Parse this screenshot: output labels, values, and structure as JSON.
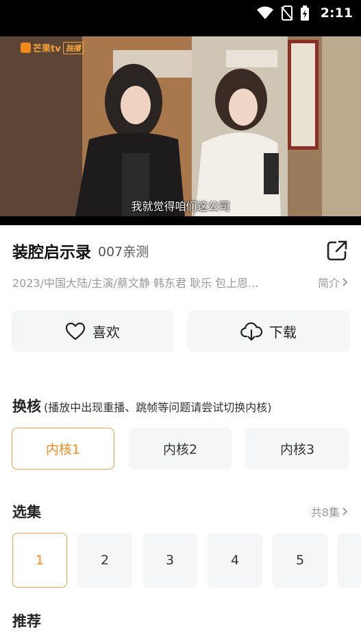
{
  "status_bar": {
    "time": "2:11",
    "icons": [
      "wifi-icon",
      "no-sim-icon",
      "battery-charging-icon"
    ]
  },
  "video": {
    "logo_text": "芒果tv",
    "logo_tag": "独播",
    "subtitle": "我就觉得咱们这公司"
  },
  "show": {
    "title": "装腔启示录",
    "source": "007亲测",
    "meta": "2023/中国大陆/主演/蔡文静  韩东君  耿乐  包上恩...",
    "intro_label": "简介"
  },
  "actions": {
    "like_label": "喜欢",
    "download_label": "下载"
  },
  "core": {
    "title": "换核",
    "note": "(播放中出现重播、跳帧等问题请尝试切换内核)",
    "options": [
      "内核1",
      "内核2",
      "内核3"
    ],
    "selected": "内核1"
  },
  "episodes": {
    "title": "选集",
    "count_label": "共8集",
    "items": [
      "1",
      "2",
      "3",
      "4",
      "5"
    ],
    "selected": "1"
  },
  "recommend": {
    "title": "推荐"
  },
  "colors": {
    "accent": "#f08a1b",
    "button_bg": "#f5f6f8",
    "muted_text": "#9a9a9a"
  }
}
